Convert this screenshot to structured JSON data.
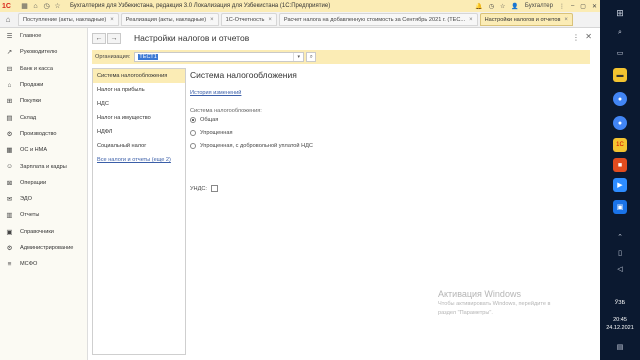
{
  "titlebar": {
    "title": "Бухгалтерия для Узбекистана, редакция 3.0 Локализация для Узбекистана  (1С:Предприятие)",
    "user": "Бухгалтер",
    "logo": "1С"
  },
  "tabs": [
    {
      "label": "Поступление (акты, накладные)",
      "active": false
    },
    {
      "label": "Реализация (акты, накладные)",
      "active": false
    },
    {
      "label": "1С-Отчетность",
      "active": false
    },
    {
      "label": "Расчет налога на добавленную стоимость за Сентябрь 2021 г. (ТЕС...",
      "active": false
    },
    {
      "label": "Настройки налогов и отчетов",
      "active": true
    }
  ],
  "sidebar": {
    "items": [
      {
        "label": "Главное",
        "icon": "menu-icon",
        "glyph": "☰"
      },
      {
        "label": "Руководителю",
        "icon": "chart-icon",
        "glyph": "↗"
      },
      {
        "label": "Банк и касса",
        "icon": "bank-icon",
        "glyph": "⊟"
      },
      {
        "label": "Продажи",
        "icon": "cart-icon",
        "glyph": "⌂"
      },
      {
        "label": "Покупки",
        "icon": "basket-icon",
        "glyph": "⊞"
      },
      {
        "label": "Склад",
        "icon": "warehouse-icon",
        "glyph": "▤"
      },
      {
        "label": "Производство",
        "icon": "factory-icon",
        "glyph": "⚙"
      },
      {
        "label": "ОС и НМА",
        "icon": "assets-icon",
        "glyph": "▦"
      },
      {
        "label": "Зарплата и кадры",
        "icon": "people-icon",
        "glyph": "☺"
      },
      {
        "label": "Операции",
        "icon": "operations-icon",
        "glyph": "⊠"
      },
      {
        "label": "ЭДО",
        "icon": "edo-icon",
        "glyph": "✉"
      },
      {
        "label": "Отчеты",
        "icon": "reports-icon",
        "glyph": "▥"
      },
      {
        "label": "Справочники",
        "icon": "book-icon",
        "glyph": "▣"
      },
      {
        "label": "Администрирование",
        "icon": "gear-icon",
        "glyph": "⚙"
      },
      {
        "label": "МСФО",
        "icon": "ifrs-icon",
        "glyph": "≡"
      }
    ]
  },
  "main": {
    "title": "Настройки налогов и отчетов",
    "org_label": "Организация:",
    "org_value": "ТЕСТ1",
    "left_items": [
      {
        "label": "Система налогообложения",
        "selected": true
      },
      {
        "label": "Налог на прибыль",
        "selected": false
      },
      {
        "label": "НДС",
        "selected": false
      },
      {
        "label": "Налог на имущество",
        "selected": false
      },
      {
        "label": "НДФЛ",
        "selected": false
      },
      {
        "label": "Социальный налог",
        "selected": false
      }
    ],
    "all_taxes_link": "Все налоги и отчеты (еще 2)",
    "section_title": "Система налогообложения",
    "history_link": "История изменений",
    "group_label": "Система налогообложения:",
    "radios": [
      {
        "label": "Общая",
        "checked": true
      },
      {
        "label": "Упрощенная",
        "checked": false
      },
      {
        "label": "Упрощенная, с добровольной уплатой НДС",
        "checked": false
      }
    ],
    "vat_label": "УНДС:"
  },
  "watermark": {
    "title": "Активация Windows",
    "line1": "Чтобы активировать Windows, перейдите в",
    "line2": "раздел \"Параметры\"."
  },
  "taskbar": {
    "lang": "ЎЗБ",
    "time": "20:45",
    "date": "24.12.2021"
  }
}
